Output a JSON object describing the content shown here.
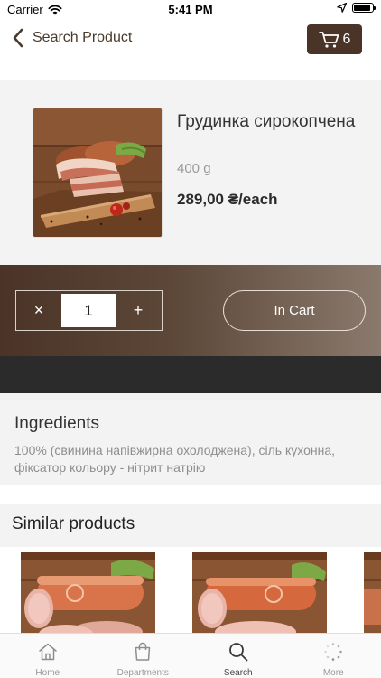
{
  "status_bar": {
    "carrier": "Carrier",
    "time": "5:41 PM",
    "battery_level": 0.9
  },
  "nav": {
    "back_label": "Search Product",
    "cart_count": "6",
    "icons": {
      "back": "chevron-left-icon",
      "cart": "cart-icon"
    }
  },
  "product": {
    "name": "Грудинка сирокопчена",
    "weight": "400 g",
    "price": "289,00 ₴/each"
  },
  "quantity": {
    "decrement_label": "×",
    "value": "1",
    "increment_label": "+"
  },
  "cart_button": {
    "label": "In Cart"
  },
  "ingredients": {
    "title": "Ingredients",
    "text": "100% (свинина напівжирна охолоджена), сіль кухонна, фіксатор кольору - нітрит натрію"
  },
  "similar": {
    "title": "Similar products"
  },
  "tabs": [
    {
      "label": "Home",
      "icon": "home-icon"
    },
    {
      "label": "Departments",
      "icon": "bag-icon"
    },
    {
      "label": "Search",
      "icon": "search-icon",
      "active": true
    },
    {
      "label": "More",
      "icon": "more-icon"
    }
  ],
  "colors": {
    "brand_brown": "#4a3428",
    "accent_text": "#4a3a2c"
  }
}
